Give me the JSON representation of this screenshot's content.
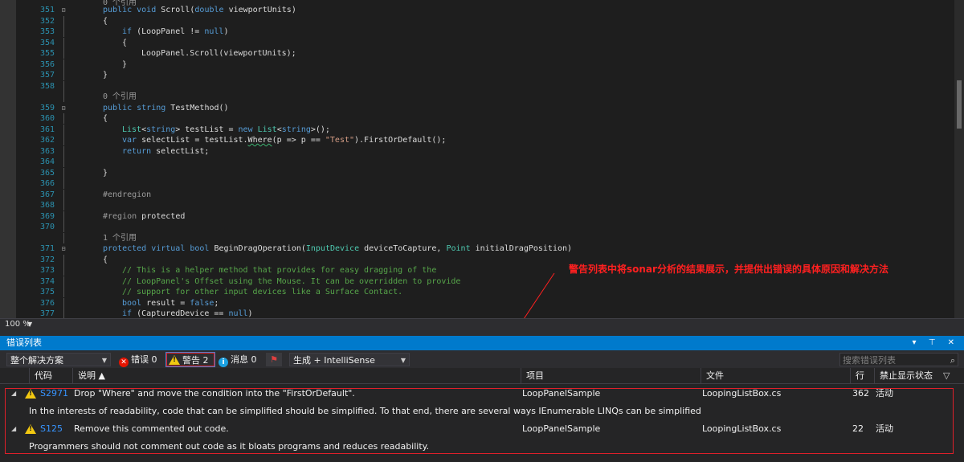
{
  "editor": {
    "top_ref": "0 个引用",
    "lines": [
      {
        "n": "351",
        "tokens": [
          [
            "kw",
            "public void "
          ],
          [
            "",
            "Scroll("
          ],
          [
            "kw",
            "double "
          ],
          [
            "",
            "viewportUnits)"
          ]
        ],
        "indent": 1
      },
      {
        "n": "352",
        "tokens": [
          [
            "",
            "{"
          ]
        ],
        "indent": 1
      },
      {
        "n": "353",
        "tokens": [
          [
            "kw",
            "if "
          ],
          [
            "",
            "(LoopPanel != "
          ],
          [
            "kw",
            "null"
          ],
          [
            "",
            ")"
          ]
        ],
        "indent": 2
      },
      {
        "n": "354",
        "tokens": [
          [
            "",
            "{"
          ]
        ],
        "indent": 2
      },
      {
        "n": "355",
        "tokens": [
          [
            "",
            "LoopPanel.Scroll(viewportUnits);"
          ]
        ],
        "indent": 3
      },
      {
        "n": "356",
        "tokens": [
          [
            "",
            "}"
          ]
        ],
        "indent": 2
      },
      {
        "n": "357",
        "tokens": [
          [
            "",
            "}"
          ]
        ],
        "indent": 1
      },
      {
        "n": "358",
        "tokens": [],
        "indent": 0
      },
      {
        "n": "",
        "ref": "0 个引用",
        "tokens": [],
        "indent": 1
      },
      {
        "n": "359",
        "tokens": [
          [
            "kw",
            "public string "
          ],
          [
            "",
            "TestMethod()"
          ]
        ],
        "indent": 1
      },
      {
        "n": "360",
        "tokens": [
          [
            "",
            "{"
          ]
        ],
        "indent": 1
      },
      {
        "n": "361",
        "tokens": [
          [
            "ty",
            "List"
          ],
          [
            "",
            "<"
          ],
          [
            "kw",
            "string"
          ],
          [
            "",
            "> testList = "
          ],
          [
            "kw",
            "new "
          ],
          [
            "ty",
            "List"
          ],
          [
            "",
            "<"
          ],
          [
            "kw",
            "string"
          ],
          [
            "",
            ">();"
          ]
        ],
        "indent": 2
      },
      {
        "n": "362",
        "tokens": [
          [
            "kw",
            "var "
          ],
          [
            "",
            "selectList = testList."
          ],
          [
            "sq",
            "Where"
          ],
          [
            "",
            "(p => p == "
          ],
          [
            "str",
            "\"Test\""
          ],
          [
            "",
            ").FirstOrDefault();"
          ]
        ],
        "indent": 2
      },
      {
        "n": "363",
        "tokens": [
          [
            "kw",
            "return "
          ],
          [
            "",
            "selectList;"
          ]
        ],
        "indent": 2
      },
      {
        "n": "364",
        "tokens": [],
        "indent": 0
      },
      {
        "n": "365",
        "tokens": [
          [
            "",
            "}"
          ]
        ],
        "indent": 1
      },
      {
        "n": "366",
        "tokens": [],
        "indent": 0
      },
      {
        "n": "367",
        "tokens": [
          [
            "pre",
            "#endregion"
          ]
        ],
        "indent": 1
      },
      {
        "n": "368",
        "tokens": [],
        "indent": 0
      },
      {
        "n": "369",
        "tokens": [
          [
            "pre",
            "#region "
          ],
          [
            "",
            "protected"
          ]
        ],
        "indent": 1
      },
      {
        "n": "370",
        "tokens": [],
        "indent": 0
      },
      {
        "n": "",
        "ref": "1 个引用",
        "tokens": [],
        "indent": 1
      },
      {
        "n": "371",
        "tokens": [
          [
            "kw",
            "protected virtual bool "
          ],
          [
            "",
            "BeginDragOperation("
          ],
          [
            "ty",
            "InputDevice "
          ],
          [
            "",
            "deviceToCapture, "
          ],
          [
            "ty",
            "Point "
          ],
          [
            "",
            "initialDragPosition)"
          ]
        ],
        "indent": 1
      },
      {
        "n": "372",
        "tokens": [
          [
            "",
            "{"
          ]
        ],
        "indent": 1
      },
      {
        "n": "373",
        "tokens": [
          [
            "cm",
            "// This is a helper method that provides for easy dragging of the"
          ]
        ],
        "indent": 2
      },
      {
        "n": "374",
        "tokens": [
          [
            "cm",
            "// LoopPanel's Offset using the Mouse. It can be overridden to provide"
          ]
        ],
        "indent": 2
      },
      {
        "n": "375",
        "tokens": [
          [
            "cm",
            "// support for other input devices like a Surface Contact."
          ]
        ],
        "indent": 2
      },
      {
        "n": "376",
        "tokens": [
          [
            "kw",
            "bool "
          ],
          [
            "",
            "result = "
          ],
          [
            "kw",
            "false"
          ],
          [
            "",
            ";"
          ]
        ],
        "indent": 2
      },
      {
        "n": "377",
        "tokens": [
          [
            "kw",
            "if "
          ],
          [
            "",
            "(CapturedDevice == "
          ],
          [
            "kw",
            "null"
          ],
          [
            "",
            ")"
          ]
        ],
        "indent": 2
      }
    ],
    "annotation": "警告列表中将sonar分析的结果展示，并提供出错误的具体原因和解决方法"
  },
  "status": {
    "zoom": "100 %"
  },
  "error_list": {
    "title": "错误列表",
    "title_icons": "▾ ⊤ ✕",
    "toolbar": {
      "scope": "整个解决方案",
      "errors_label": "错误 0",
      "warnings_label": "警告 2",
      "messages_label": "消息 0",
      "build_filter": "生成 + IntelliSense",
      "search_placeholder": "搜索错误列表"
    },
    "columns": {
      "code": "代码",
      "description": "说明 ▲",
      "project": "项目",
      "file": "文件",
      "line": "行",
      "suppression": "禁止显示状态"
    },
    "rows": [
      {
        "code": "S2971",
        "description": "Drop \"Where\" and move the condition into the \"FirstOrDefault\".",
        "detail": "In the interests of readability, code that can be simplified should be simplified. To that end, there are several ways IEnumerable LINQs can be simplified",
        "project": "LoopPanelSample",
        "file": "LoopingListBox.cs",
        "line": "362",
        "state": "活动"
      },
      {
        "code": "S125",
        "description": "Remove this commented out code.",
        "detail": "Programmers should not comment out code as it bloats programs and reduces readability.",
        "project": "LoopPanelSample",
        "file": "LoopingListBox.cs",
        "line": "22",
        "state": "活动"
      }
    ]
  }
}
